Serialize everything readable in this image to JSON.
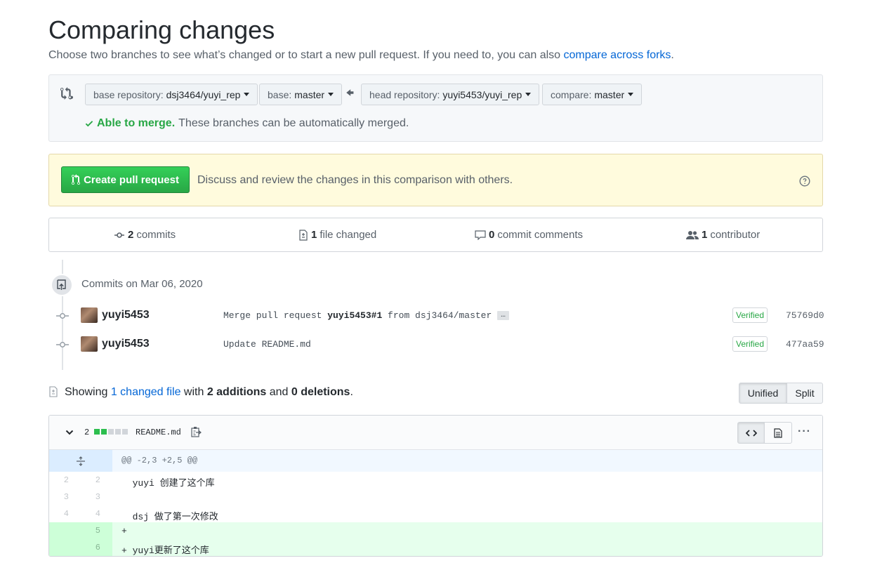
{
  "page": {
    "title": "Comparing changes",
    "subtitle_prefix": "Choose two branches to see what’s changed or to start a new pull request. If you need to, you can also ",
    "subtitle_link": "compare across forks",
    "subtitle_suffix": "."
  },
  "range": {
    "base_repo_label": "base repository:",
    "base_repo_value": "dsj3464/yuyi_rep",
    "base_label": "base:",
    "base_value": "master",
    "head_repo_label": "head repository:",
    "head_repo_value": "yuyi5453/yuyi_rep",
    "compare_label": "compare:",
    "compare_value": "master",
    "merge_ok": "Able to merge.",
    "merge_text": "These branches can be automatically merged."
  },
  "pr": {
    "button_label": "Create pull request",
    "description": "Discuss and review the changes in this comparison with others."
  },
  "summary": {
    "commits_count": "2",
    "commits_label": "commits",
    "files_count": "1",
    "files_label": "file changed",
    "comments_count": "0",
    "comments_label": "commit comments",
    "contributors_count": "1",
    "contributors_label": "contributor"
  },
  "timeline": {
    "date_heading": "Commits on Mar 06, 2020",
    "commits": [
      {
        "author": "yuyi5453",
        "msg_prefix": "Merge pull request ",
        "msg_bold": "yuyi5453#1",
        "msg_suffix": " from dsj3464/master",
        "ellipsis": "…",
        "verified": "Verified",
        "sha": "75769d0"
      },
      {
        "author": "yuyi5453",
        "msg_prefix": "Update README.md",
        "msg_bold": "",
        "msg_suffix": "",
        "verified": "Verified",
        "sha": "477aa59"
      }
    ]
  },
  "showing": {
    "prefix": "Showing ",
    "link": "1 changed file",
    "mid": " with ",
    "additions": "2 additions",
    "and": " and ",
    "deletions": "0 deletions",
    "suffix": ".",
    "unified_label": "Unified",
    "split_label": "Split"
  },
  "file": {
    "diffstat": "2",
    "diffstat_blocks": {
      "added": 2,
      "neutral": 3
    },
    "name": "README.md",
    "hunk_header": "@@ -2,3 +2,5 @@",
    "more": "···",
    "lines": [
      {
        "old": "2",
        "new": "2",
        "type": "context",
        "text": "  yuyi 创建了这个库"
      },
      {
        "old": "3",
        "new": "3",
        "type": "context",
        "text": ""
      },
      {
        "old": "4",
        "new": "4",
        "type": "context",
        "text": "  dsj 做了第一次修改"
      },
      {
        "old": "",
        "new": "5",
        "type": "add",
        "text": "+"
      },
      {
        "old": "",
        "new": "6",
        "type": "add",
        "text": "+ yuyi更新了这个库"
      }
    ]
  },
  "colors": {
    "green": "#28a745",
    "link": "#0366d6",
    "add_bg": "#e6ffed",
    "hunk_bg": "#f1f8ff"
  }
}
